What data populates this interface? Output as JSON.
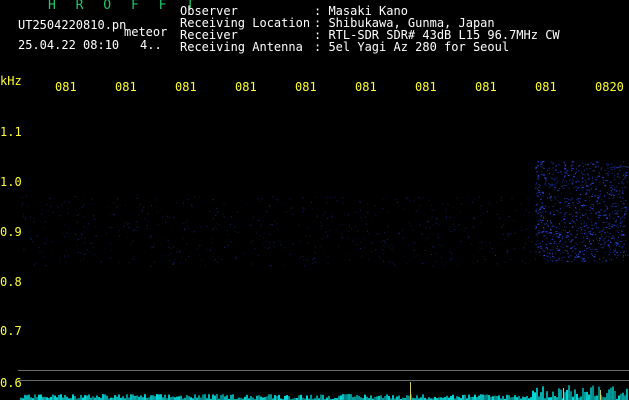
{
  "header": {
    "title": "H R O F F T",
    "filename": "UT2504220810.pn",
    "mode": "meteor",
    "datetime": "25.04.22 08:10",
    "count": "4.."
  },
  "info": [
    {
      "label": "Observer",
      "value": ": Masaki Kano"
    },
    {
      "label": "Receiving Location",
      "value": ": Shibukawa, Gunma, Japan"
    },
    {
      "label": "Receiver",
      "value": ": RTL-SDR SDR# 43dB L15 96.7MHz CW"
    },
    {
      "label": "Receiving Antenna",
      "value": ": 5el Yagi Az 280 for Seoul"
    }
  ],
  "time_axis": [
    "081",
    "081",
    "081",
    "081",
    "081",
    "081",
    "081",
    "081",
    "081",
    "0820"
  ],
  "freq_axis": {
    "unit": "kHz",
    "ticks": [
      "1.1",
      "1.0",
      "0.9",
      "0.8",
      "0.7",
      "0.6"
    ]
  },
  "colors": {
    "header_title": "#22c86a",
    "axis_text": "#ffff33",
    "echo_blue": "#3050ff",
    "noise_cyan": "#00e5e5"
  }
}
